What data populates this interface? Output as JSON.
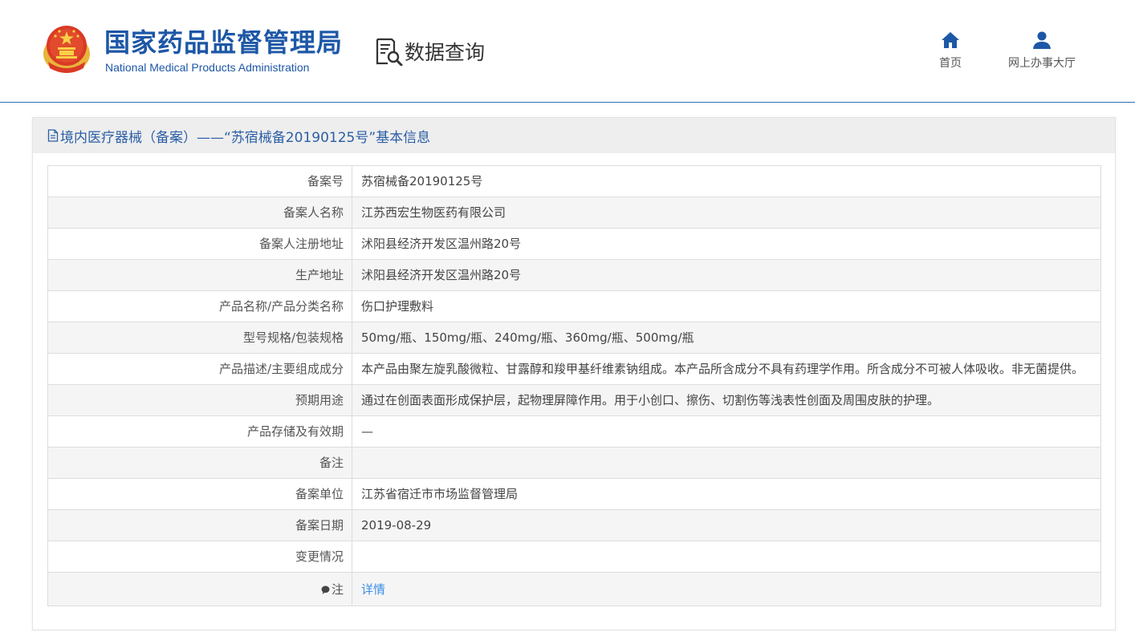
{
  "header": {
    "org_name_cn": "国家药品监督管理局",
    "org_name_en": "National Medical Products Administration",
    "query_label": "数据查询",
    "nav": {
      "home_label": "首页",
      "hall_label": "网上办事大厅"
    }
  },
  "panel": {
    "title": "境内医疗器械（备案）——“苏宿械备20190125号”基本信息"
  },
  "table": {
    "rows": [
      {
        "label": "备案号",
        "value": "苏宿械备20190125号"
      },
      {
        "label": "备案人名称",
        "value": "江苏西宏生物医药有限公司"
      },
      {
        "label": "备案人注册地址",
        "value": "沭阳县经济开发区温州路20号"
      },
      {
        "label": "生产地址",
        "value": "沭阳县经济开发区温州路20号"
      },
      {
        "label": "产品名称/产品分类名称",
        "value": "伤口护理敷料"
      },
      {
        "label": "型号规格/包装规格",
        "value": "50mg/瓶、150mg/瓶、240mg/瓶、360mg/瓶、500mg/瓶"
      },
      {
        "label": "产品描述/主要组成成分",
        "value": "本产品由聚左旋乳酸微粒、甘露醇和羧甲基纤维素钠组成。本产品所含成分不具有药理学作用。所含成分不可被人体吸收。非无菌提供。"
      },
      {
        "label": "预期用途",
        "value": "通过在创面表面形成保护层，起物理屏障作用。用于小创口、擦伤、切割伤等浅表性创面及周围皮肤的护理。"
      },
      {
        "label": "产品存储及有效期",
        "value": "—"
      },
      {
        "label": "备注",
        "value": ""
      },
      {
        "label": "备案单位",
        "value": "江苏省宿迁市市场监督管理局"
      },
      {
        "label": "备案日期",
        "value": "2019-08-29"
      },
      {
        "label": "变更情况",
        "value": ""
      }
    ],
    "note_label": "注",
    "note_link": "详情"
  },
  "colors": {
    "brand_blue": "#1d57a6",
    "link_blue": "#3a8ee6"
  }
}
